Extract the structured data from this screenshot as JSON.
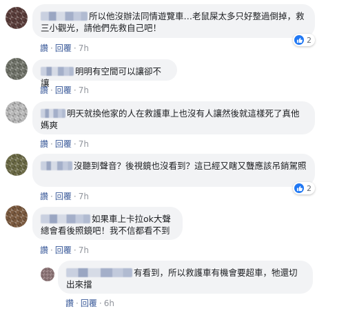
{
  "comments": [
    {
      "text": "所以他沒辦法同情遊覽車…老鼠屎太多只好整過倒掉，救三小觀光，請他們先救自己吧！",
      "reply_label": "讚",
      "sep": "·",
      "reply2_label": "回覆",
      "time": "7h",
      "reaction_count": "2",
      "avatar_colors": [
        "#5a3d3a",
        "#8a6a68"
      ]
    },
    {
      "text": "明明有空間可以讓卻不讓",
      "reply_label": "讚",
      "sep": "·",
      "reply2_label": "回覆",
      "time": "7h",
      "reaction_count": "",
      "avatar_colors": [
        "#6f7268",
        "#a9ab9f"
      ]
    },
    {
      "text": "明天就換他家的人在救護車上也沒有人讓然後就這樣死了真他媽爽",
      "reply_label": "讚",
      "sep": "·",
      "reply2_label": "回覆",
      "time": "7h",
      "reaction_count": "",
      "avatar_colors": [
        "#b8b8b8",
        "#e3e3e3"
      ]
    },
    {
      "text": "沒聽到聲音？後視鏡也沒看到？這已經又瞎又聾應該吊銷駕照",
      "reply_label": "讚",
      "sep": "·",
      "reply2_label": "回覆",
      "time": "7h",
      "reaction_count": "2",
      "avatar_colors": [
        "#6b6a45",
        "#b9b58a"
      ]
    },
    {
      "text": "如果車上卡拉ok大聲總會看後照鏡吧！我不信都看不到",
      "reply_label": "讚",
      "sep": "·",
      "reply2_label": "回覆",
      "time": "7h",
      "reaction_count": "",
      "avatar_colors": [
        "#7b5a3f",
        "#c39a6e"
      ]
    },
    {
      "text": "有看到，所以救護車有機會要超車，牠還切出來擋",
      "reply_label": "讚",
      "sep": "·",
      "reply2_label": "回覆",
      "time": "6h",
      "reaction_count": "",
      "avatar_colors": [
        "#8d7476",
        "#d8c3c4"
      ]
    }
  ]
}
